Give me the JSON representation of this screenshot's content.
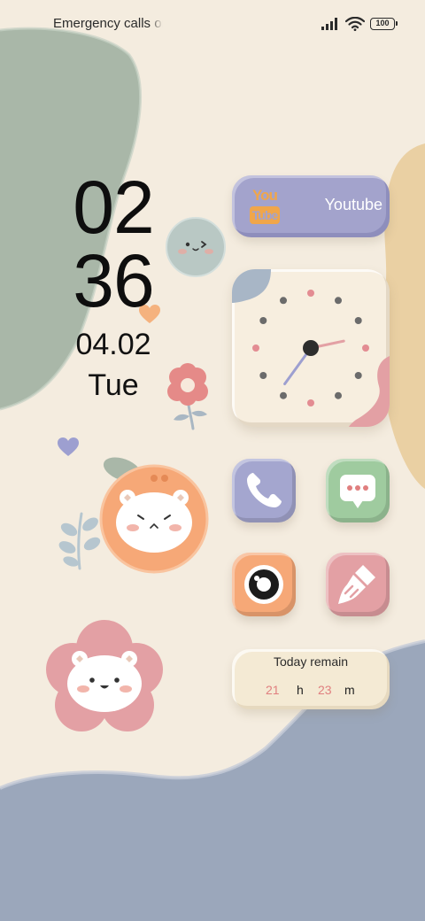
{
  "status_bar": {
    "carrier_text": "Emergency calls only",
    "battery_level": "100",
    "icons": [
      "signal-icon",
      "wifi-icon",
      "battery-icon"
    ]
  },
  "clock": {
    "hour": "02",
    "minute": "36",
    "date": "04.02",
    "weekday": "Tue"
  },
  "widgets": {
    "youtube": {
      "logo_top": "You",
      "logo_bottom": "Tube",
      "label": "Youtube"
    },
    "analog_clock": {
      "hour": 2,
      "minute": 36
    },
    "today_remain": {
      "title": "Today remain",
      "hours": "21",
      "hours_unit": "h",
      "minutes": "23",
      "minutes_unit": "m"
    }
  },
  "apps": [
    {
      "name": "Phone",
      "icon": "phone-icon"
    },
    {
      "name": "Messages",
      "icon": "message-icon"
    },
    {
      "name": "Camera",
      "icon": "camera-icon"
    },
    {
      "name": "Cleaner",
      "icon": "broom-icon"
    }
  ],
  "colors": {
    "background": "#f4ecdf",
    "sage": "#a9b7a8",
    "slate_blue": "#9ba7bb",
    "sand": "#ead0a3",
    "lavender": "#a3a3cc",
    "mint": "#9fcb9f",
    "peach": "#f6a877",
    "rose": "#e3a0a4",
    "accent_red": "#e07f7f"
  }
}
